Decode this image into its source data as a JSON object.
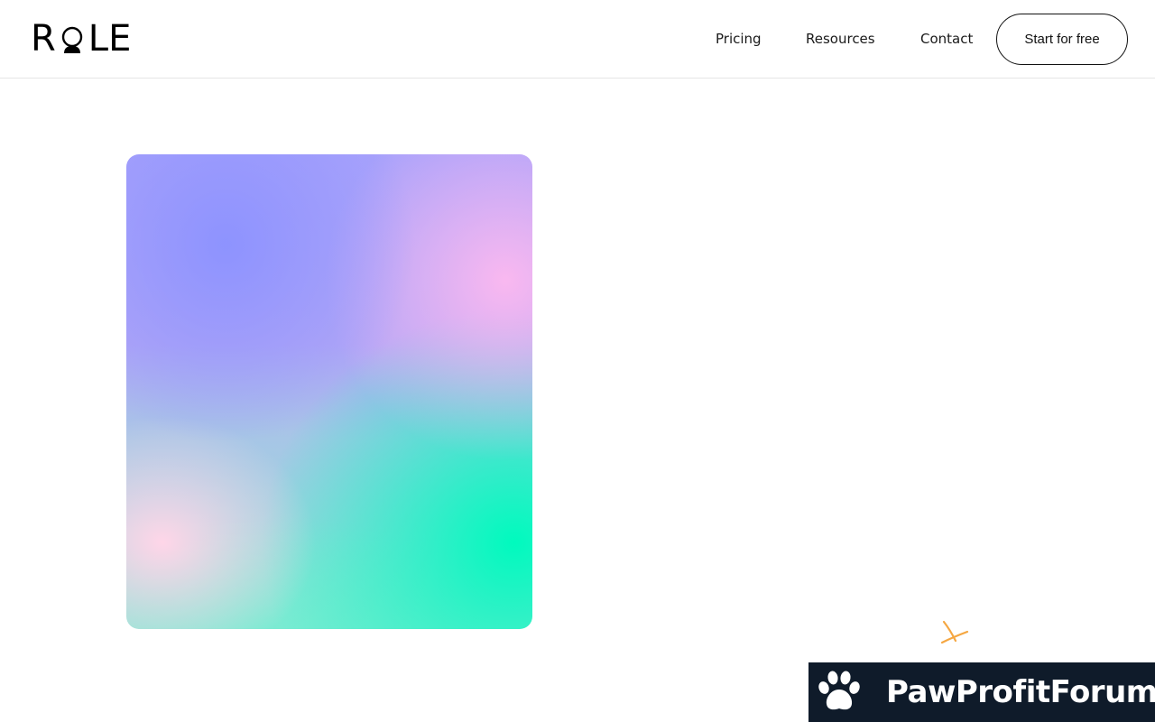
{
  "brand": {
    "logo_letters_left": "R",
    "logo_letters_right": "LE",
    "logo_full": "ROLE"
  },
  "nav": {
    "items": [
      {
        "label": "Pricing"
      },
      {
        "label": "Resources"
      },
      {
        "label": "Contact"
      }
    ],
    "cta_label": "Start for free"
  },
  "hero": {
    "gradient_colors": [
      "#8c92ff",
      "#f9b8f0",
      "#ffd6e8",
      "#00fabe",
      "#78ecd2"
    ]
  },
  "decoration": {
    "spark_color": "#f5a742",
    "icon": "sparkle-icon"
  },
  "overlay_banner": {
    "icon": "paw-icon",
    "label": "PawProfitForum",
    "background": "#0f1b2a",
    "text_color": "#ffffff"
  }
}
